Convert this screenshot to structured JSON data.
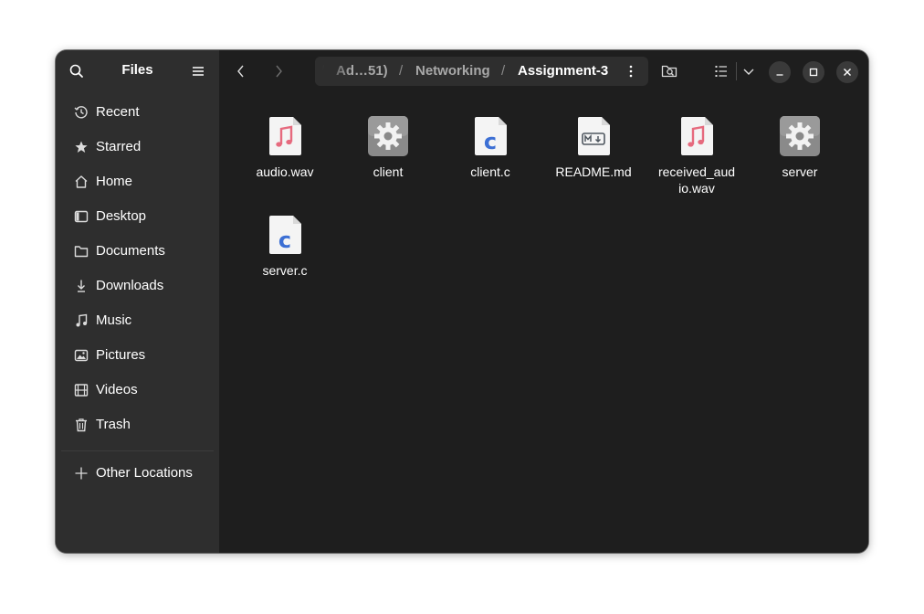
{
  "sidebar": {
    "title": "Files",
    "items": [
      {
        "label": "Recent",
        "icon": "clock-icon"
      },
      {
        "label": "Starred",
        "icon": "star-icon"
      },
      {
        "label": "Home",
        "icon": "home-icon"
      },
      {
        "label": "Desktop",
        "icon": "desktop-icon"
      },
      {
        "label": "Documents",
        "icon": "documents-icon"
      },
      {
        "label": "Downloads",
        "icon": "download-icon"
      },
      {
        "label": "Music",
        "icon": "music-icon"
      },
      {
        "label": "Pictures",
        "icon": "pictures-icon"
      },
      {
        "label": "Videos",
        "icon": "videos-icon"
      },
      {
        "label": "Trash",
        "icon": "trash-icon"
      }
    ],
    "other_locations": "Other Locations"
  },
  "pathbar": {
    "crumbs": [
      "Ad…51)",
      "Networking",
      "Assignment-3"
    ],
    "separator": "/"
  },
  "files": [
    {
      "name": "audio.wav",
      "type": "audio"
    },
    {
      "name": "client",
      "type": "executable"
    },
    {
      "name": "client.c",
      "type": "c-source"
    },
    {
      "name": "README.md",
      "type": "markdown"
    },
    {
      "name": "received_audio.wav",
      "type": "audio"
    },
    {
      "name": "server",
      "type": "executable"
    },
    {
      "name": "server.c",
      "type": "c-source"
    }
  ],
  "colors": {
    "sidebar_bg": "#2e2e2e",
    "content_bg": "#1e1e1e",
    "audio_note": "#e66a7e",
    "c_letter": "#3c6fd4"
  }
}
